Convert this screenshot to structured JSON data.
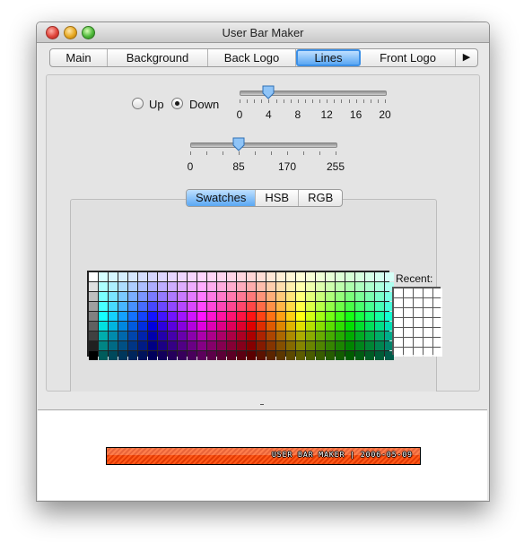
{
  "window": {
    "title": "User Bar Maker"
  },
  "tabs": [
    "Main",
    "Background",
    "Back Logo",
    "Lines",
    "Front Logo"
  ],
  "selected_tab": "Lines",
  "tab_more_icon": "triangle-right-icon",
  "direction": {
    "options": [
      "Up",
      "Down"
    ],
    "selected": "Down"
  },
  "spacing_slider": {
    "value": 4,
    "min": 0,
    "max": 20,
    "labels": [
      "0",
      "4",
      "8",
      "12",
      "16",
      "20"
    ]
  },
  "alpha_slider": {
    "value": 85,
    "min": 0,
    "max": 255,
    "labels": [
      "0",
      "85",
      "170",
      "255"
    ]
  },
  "color_picker": {
    "tabs": [
      "Swatches",
      "HSB",
      "RGB"
    ],
    "selected": "Swatches",
    "recent_label": "Recent:"
  },
  "preview": {
    "userbar_text": "USER BAR MAKER | 2006-05-09"
  },
  "colors": {
    "accent": "#5aa7f3",
    "userbar_orange": "#ff5a1a"
  }
}
